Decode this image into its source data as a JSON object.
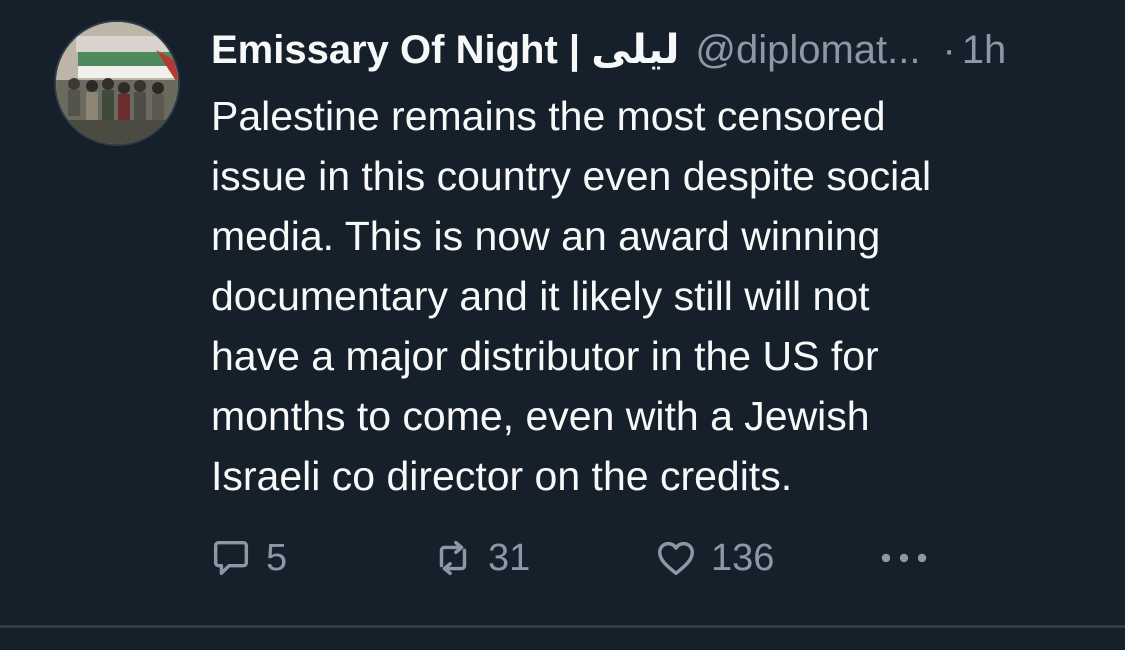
{
  "tweet": {
    "display_name": "Emissary Of Night | ليلى",
    "handle": "@diplomat...",
    "separator": "·",
    "time": "1h",
    "text": "Palestine remains the most censored\nissue in this country even despite social\nmedia. This is now an award winning\ndocumentary and it likely still will not\nhave a major distributor in the US for\nmonths to come, even with a Jewish\nIsraeli co director on the credits."
  },
  "actions": {
    "reply_count": "5",
    "retweet_count": "31",
    "like_count": "136"
  },
  "icons": {
    "reply": "reply-icon",
    "retweet": "retweet-icon",
    "like": "heart-icon",
    "more": "more-icon"
  },
  "colors": {
    "background": "#15202b",
    "text_primary": "#f7f9f9",
    "text_secondary": "#8b98a5",
    "divider": "#2f3d4a"
  }
}
